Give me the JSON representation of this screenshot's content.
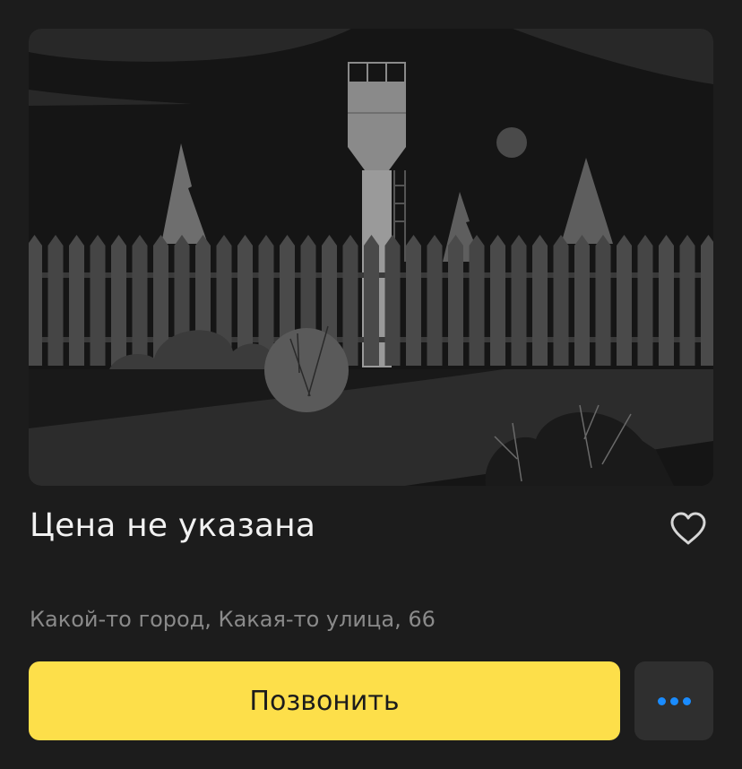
{
  "listing": {
    "price_label": "Цена не указана",
    "address": "Какой-то город, Какая-то улица, 66",
    "photo_placeholder_kind": "illustration"
  },
  "actions": {
    "call_label": "Позвонить",
    "favorite_icon": "heart-outline-icon",
    "more_icon": "more-dots-icon"
  },
  "colors": {
    "background": "#1c1c1c",
    "call_button": "#fddf4a",
    "more_button": "#2f2f2f",
    "accent": "#1a8cff",
    "secondary_text": "#8a8a8a"
  }
}
